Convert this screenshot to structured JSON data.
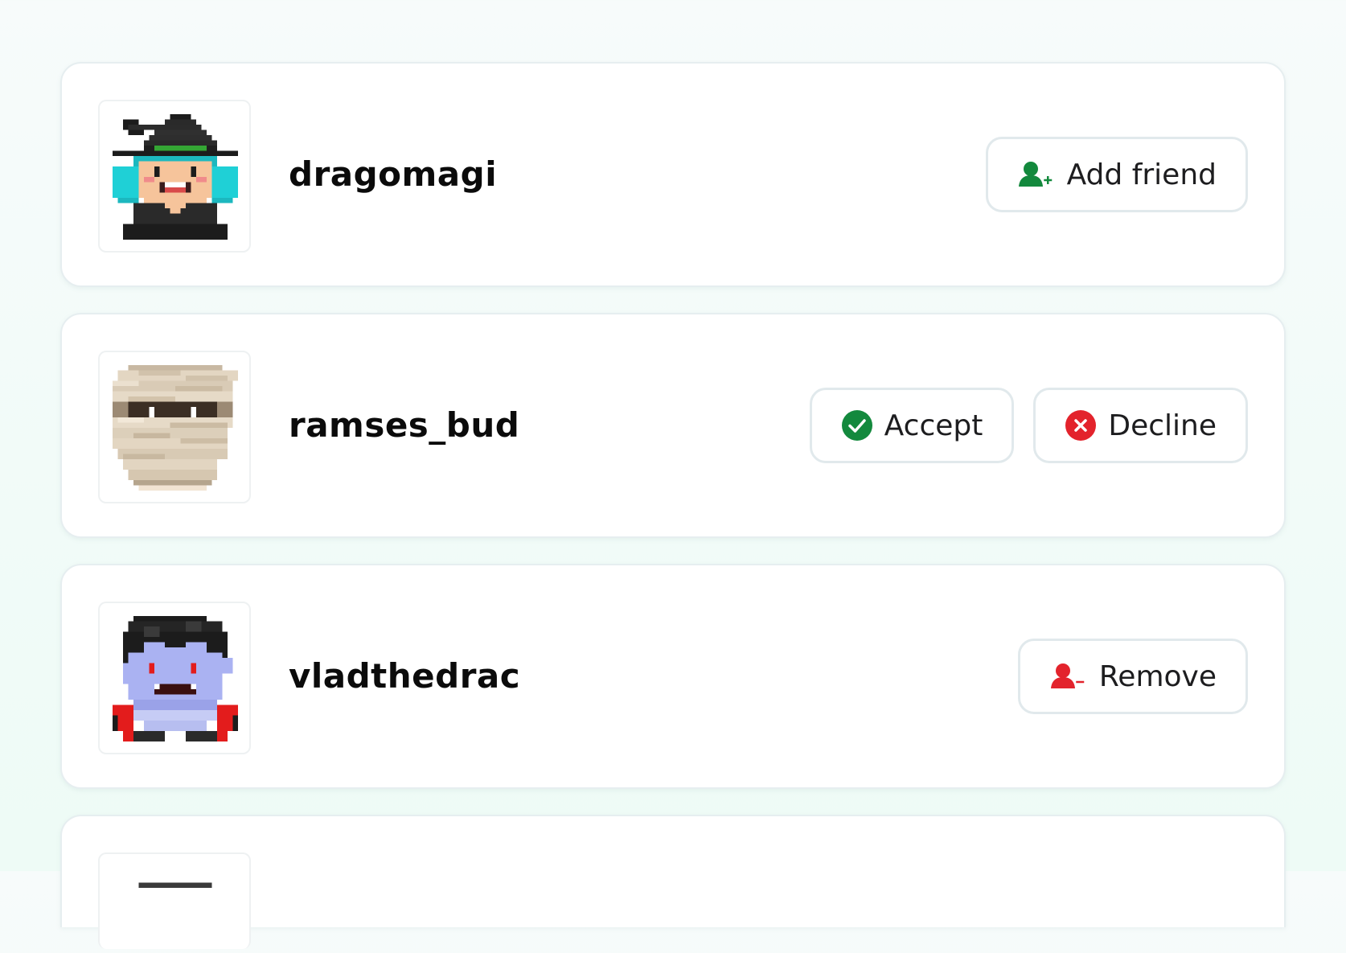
{
  "friends": [
    {
      "username": "dragomagi",
      "avatar_icon": "witch-avatar-icon",
      "actions": [
        {
          "label": "Add friend",
          "icon": "user-plus-icon",
          "color": "#13893d"
        }
      ]
    },
    {
      "username": "ramses_bud",
      "avatar_icon": "mummy-avatar-icon",
      "actions": [
        {
          "label": "Accept",
          "icon": "check-circle-icon",
          "color": "#13893d"
        },
        {
          "label": "Decline",
          "icon": "x-circle-icon",
          "color": "#e3232c"
        }
      ]
    },
    {
      "username": "vladthedrac",
      "avatar_icon": "vampire-avatar-icon",
      "actions": [
        {
          "label": "Remove",
          "icon": "user-minus-icon",
          "color": "#e3232c"
        }
      ]
    }
  ],
  "colors": {
    "accent_green": "#13893d",
    "accent_red": "#e3232c",
    "card_border": "#e6eef0"
  }
}
